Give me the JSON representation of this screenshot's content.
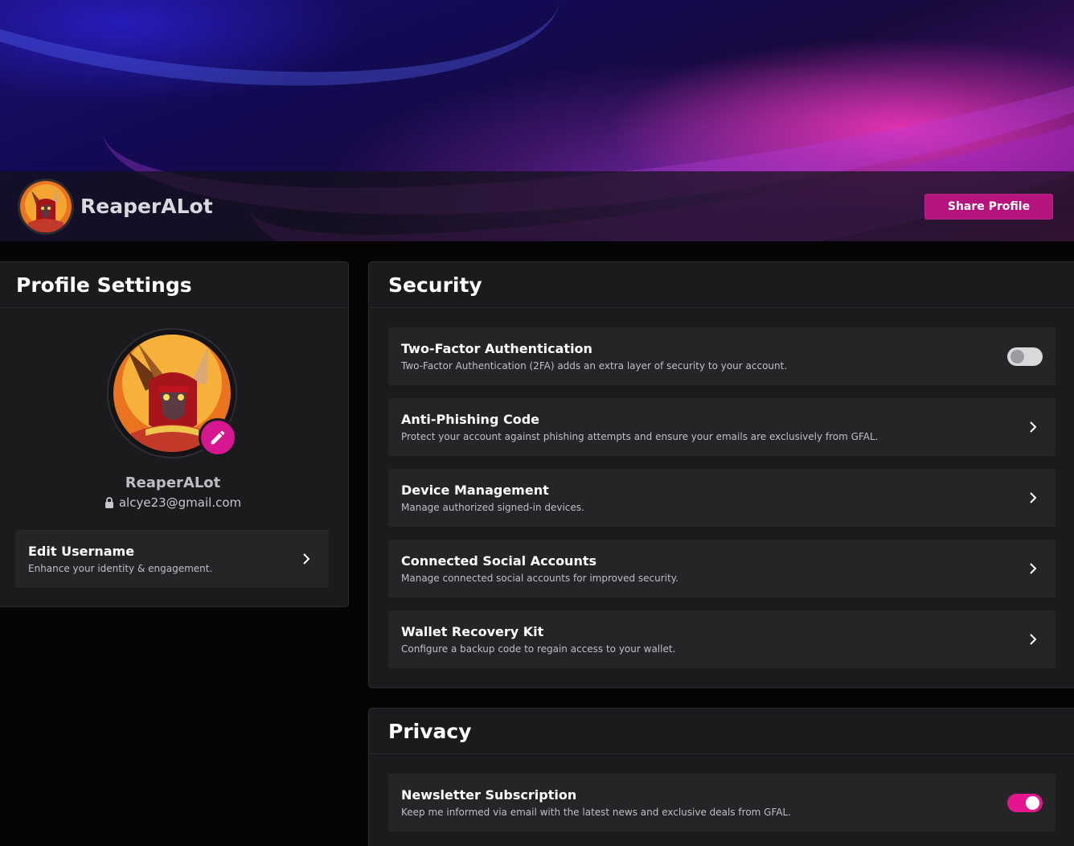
{
  "header": {
    "username": "ReaperALot",
    "share_label": "Share Profile"
  },
  "profile_settings": {
    "title": "Profile Settings",
    "username": "ReaperALot",
    "email": "alcye23@gmail.com",
    "edit_username": {
      "title": "Edit Username",
      "description": "Enhance your identity & engagement."
    }
  },
  "security": {
    "title": "Security",
    "items": [
      {
        "title": "Two-Factor Authentication",
        "description": "Two-Factor Authentication (2FA) adds an extra layer of security to your account.",
        "control": "toggle",
        "enabled": false
      },
      {
        "title": "Anti-Phishing Code",
        "description": "Protect your account against phishing attempts and ensure your emails are exclusively from GFAL.",
        "control": "chevron"
      },
      {
        "title": "Device Management",
        "description": "Manage authorized signed-in devices.",
        "control": "chevron"
      },
      {
        "title": "Connected Social Accounts",
        "description": "Manage connected social accounts for improved security.",
        "control": "chevron"
      },
      {
        "title": "Wallet Recovery Kit",
        "description": "Configure a backup code to regain access to your wallet.",
        "control": "chevron"
      }
    ]
  },
  "privacy": {
    "title": "Privacy",
    "items": [
      {
        "title": "Newsletter Subscription",
        "description": "Keep me informed via email with the latest news and exclusive deals from GFAL.",
        "control": "toggle",
        "enabled": true
      }
    ]
  },
  "colors": {
    "accent": "#d6178f",
    "button": "#b5137e",
    "card_bg": "#1b1b1e",
    "row_bg": "#252528",
    "page_bg": "#050505"
  },
  "icons": {
    "avatar": "demon-warrior-avatar",
    "edit": "pencil-icon",
    "lock": "lock-icon",
    "chevron": "chevron-right-icon"
  }
}
